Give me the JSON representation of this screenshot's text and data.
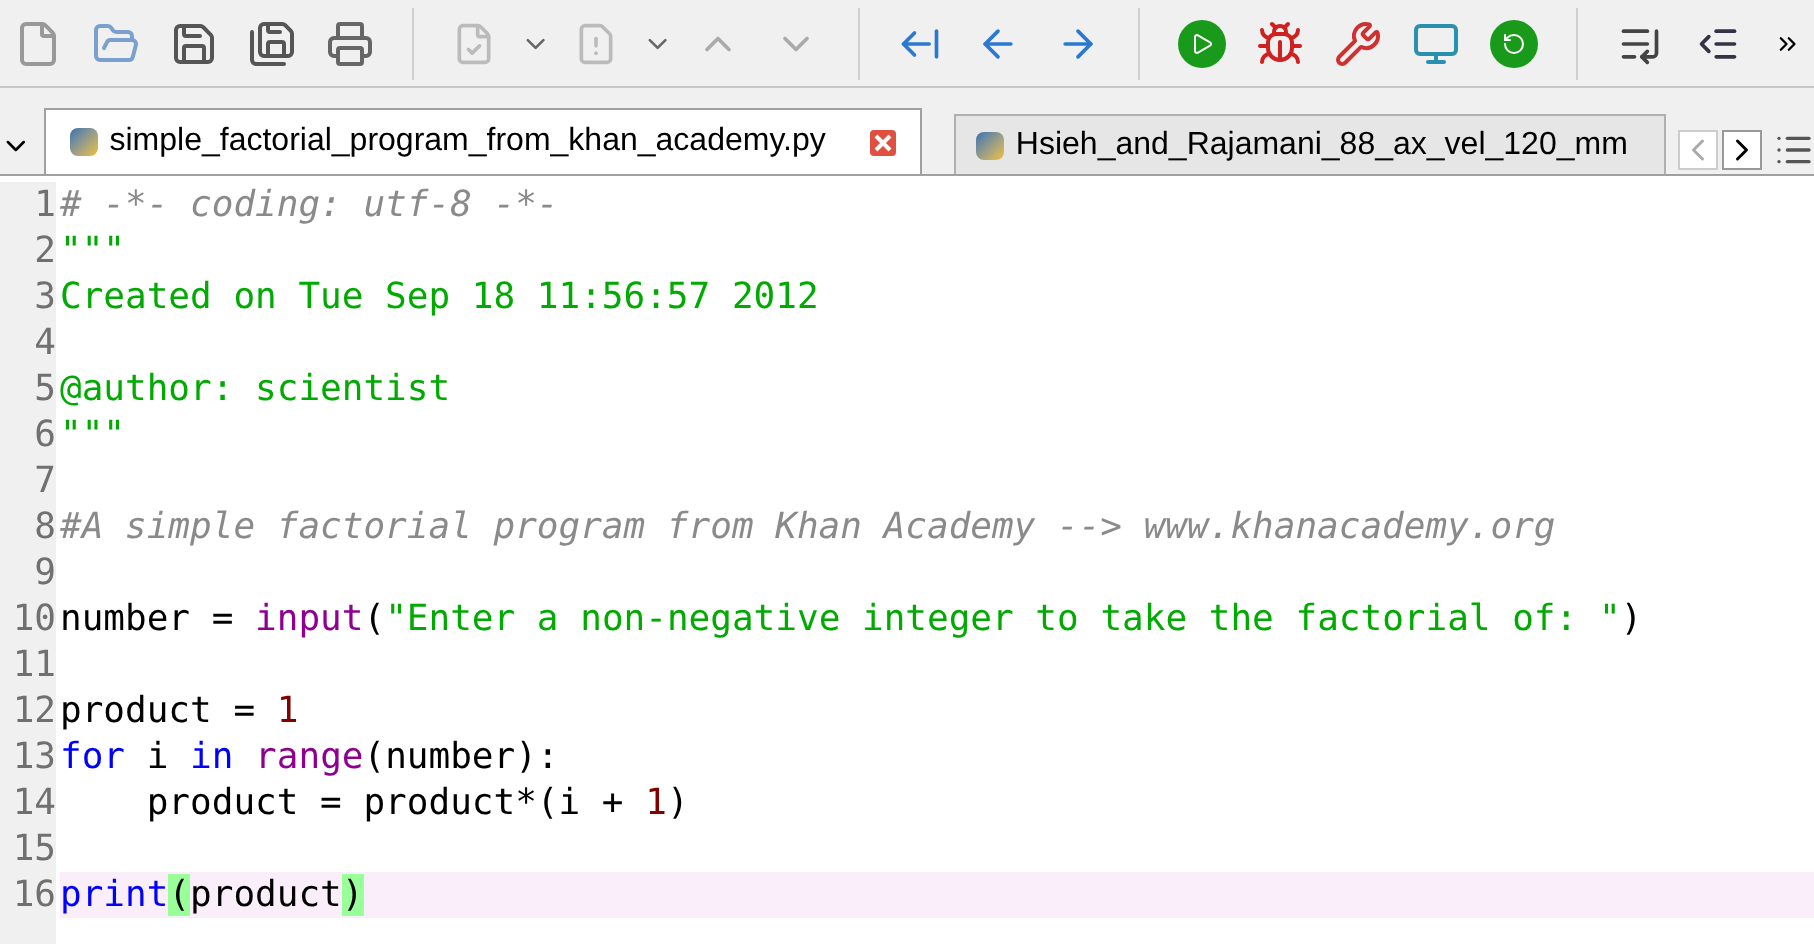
{
  "tabs": [
    {
      "label": "simple_factorial_program_from_khan_academy.py",
      "selected": true,
      "closable": true
    },
    {
      "label": "Hsieh_and_Rajamani_88_ax_vel_120_mm",
      "selected": false,
      "closable": false
    }
  ],
  "editor": {
    "lines": [
      {
        "number": "1",
        "current": false,
        "tokens": [
          {
            "kind": "comment",
            "text": "# -*- coding: utf-8 -*-"
          }
        ]
      },
      {
        "number": "2",
        "current": false,
        "tokens": [
          {
            "kind": "string",
            "text": "\"\"\""
          }
        ]
      },
      {
        "number": "3",
        "current": false,
        "tokens": [
          {
            "kind": "string",
            "text": "Created on Tue Sep 18 11:56:57 2012"
          }
        ]
      },
      {
        "number": "4",
        "current": false
      },
      {
        "number": "5",
        "current": false,
        "tokens": [
          {
            "kind": "string",
            "text": "@author: scientist"
          }
        ]
      },
      {
        "number": "6",
        "current": false,
        "tokens": [
          {
            "kind": "string",
            "text": "\"\"\""
          }
        ]
      },
      {
        "number": "7",
        "current": false
      },
      {
        "number": "8",
        "current": false,
        "tokens": [
          {
            "kind": "comment",
            "text": "#A simple factorial program from Khan Academy --> www.khanacademy.org"
          }
        ]
      },
      {
        "number": "9",
        "current": false
      },
      {
        "number": "10",
        "current": false,
        "tokens": [
          {
            "kind": "plain",
            "text": "number = "
          },
          {
            "kind": "builtin",
            "text": "input"
          },
          {
            "kind": "plain",
            "text": "("
          },
          {
            "kind": "string",
            "text": "\"Enter a non-negative integer to take the factorial of: \""
          },
          {
            "kind": "plain",
            "text": ")"
          }
        ]
      },
      {
        "number": "11",
        "current": false
      },
      {
        "number": "12",
        "current": false,
        "tokens": [
          {
            "kind": "plain",
            "text": "product = "
          },
          {
            "kind": "number",
            "text": "1"
          }
        ]
      },
      {
        "number": "13",
        "current": false,
        "tokens": [
          {
            "kind": "keyword",
            "text": "for"
          },
          {
            "kind": "plain",
            "text": " i "
          },
          {
            "kind": "keyword",
            "text": "in"
          },
          {
            "kind": "builtin",
            "text": " range"
          },
          {
            "kind": "plain",
            "text": "(number):"
          }
        ]
      },
      {
        "number": "14",
        "current": false,
        "tokens": [
          {
            "kind": "plain",
            "text": "    product = product*(i + "
          },
          {
            "kind": "number",
            "text": "1"
          },
          {
            "kind": "plain",
            "text": ")"
          }
        ]
      },
      {
        "number": "15",
        "current": false
      },
      {
        "number": "16",
        "current": true,
        "tokens": [
          {
            "kind": "keyword",
            "text": "print"
          },
          {
            "kind": "match",
            "text": "("
          },
          {
            "kind": "plain",
            "text": "product"
          },
          {
            "kind": "match",
            "text": ")"
          }
        ]
      }
    ]
  }
}
